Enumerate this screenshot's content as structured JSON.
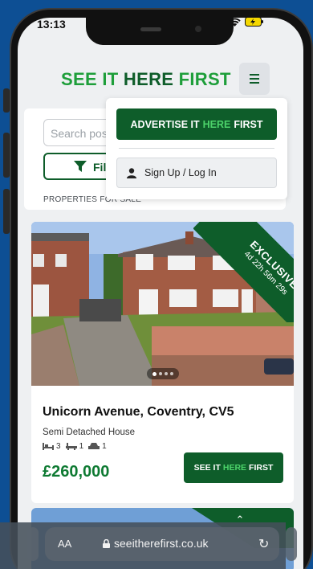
{
  "status_bar": {
    "time": "13:13"
  },
  "header": {
    "logo_part1": "SEE IT ",
    "logo_part2": "HERE",
    "logo_part3": " FIRST"
  },
  "search": {
    "placeholder": "Search pos",
    "filter_label": "Filt"
  },
  "section_label": "PROPERTIES FOR SALE",
  "menu": {
    "advertise_part1": "ADVERTISE IT",
    "advertise_part2": "HERE",
    "advertise_part3": "FIRST",
    "signup_label": "Sign Up / Log In"
  },
  "listing": {
    "ribbon_title": "EXCLUSIVE",
    "ribbon_timer": "4d 22h 56m 29s",
    "title": "Unicorn Avenue, Coventry, CV5",
    "type": "Semi Detached House",
    "beds": "3",
    "baths": "1",
    "parking": "1",
    "price": "£260,000",
    "cta_part1": "SEE IT",
    "cta_part2": "HERE",
    "cta_part3": "FIRST"
  },
  "browser": {
    "text_size": "AA",
    "url": "seeitherefirst.co.uk"
  },
  "colors": {
    "brand_dark": "#0e5d2a",
    "brand_light": "#1e9e3a",
    "accent": "#4cd36a",
    "background": "#0d4f94"
  }
}
